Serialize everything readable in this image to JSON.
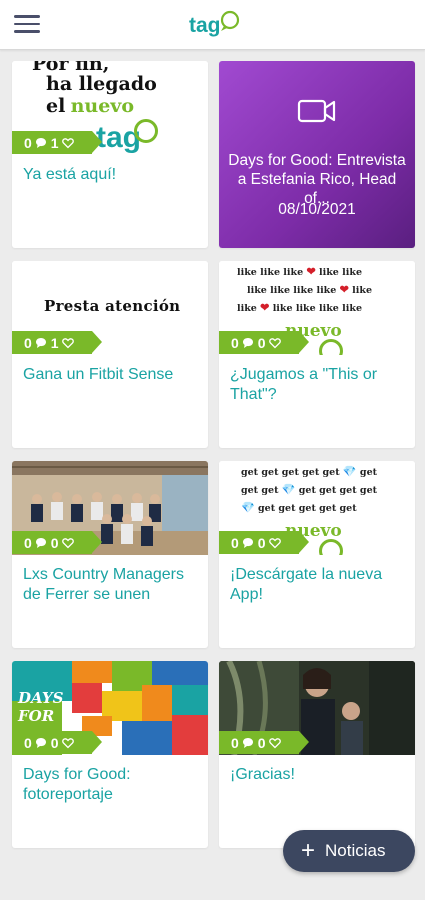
{
  "app": {
    "logo_text": "tag"
  },
  "fab": {
    "label": "Noticias"
  },
  "cards": [
    {
      "title": "Ya está aquí!",
      "comments": "0",
      "likes": "1",
      "thumb_lines": [
        "Por fin,",
        "ha llegado",
        "el",
        "nuevo",
        "tag"
      ]
    },
    {
      "title": "Days for Good: Entrevista a Estefania Rico, Head of...",
      "date": "08/10/2021"
    },
    {
      "title": "Gana un Fitbit Sense",
      "comments": "0",
      "likes": "1",
      "thumb_lines": [
        "Presta atención"
      ]
    },
    {
      "title": "¿Jugamos a \"This or That\"?",
      "comments": "0",
      "likes": "0",
      "thumb_lines": [
        "like like like ",
        "like like",
        "like like like like ",
        "like",
        "like ",
        "like like like like",
        "nuevo"
      ]
    },
    {
      "title": "Lxs Country Managers de Ferrer se unen",
      "comments": "0",
      "likes": "0"
    },
    {
      "title": "¡Descárgate la nueva App!",
      "comments": "0",
      "likes": "0",
      "thumb_lines": [
        "get get get get get ",
        " get",
        "get get ",
        " get get get get",
        " get get get get get",
        "nuevo"
      ]
    },
    {
      "title": "Days for Good: fotoreportaje",
      "comments": "0",
      "likes": "0",
      "thumb_lines": [
        "DAYS",
        "FOR"
      ]
    },
    {
      "title": "¡Gracias!",
      "comments": "0",
      "likes": "0"
    }
  ],
  "colors": {
    "teal": "#1aa3a3",
    "green": "#7ab929",
    "purple": "#8e3bbe",
    "fab": "#3c4760"
  }
}
